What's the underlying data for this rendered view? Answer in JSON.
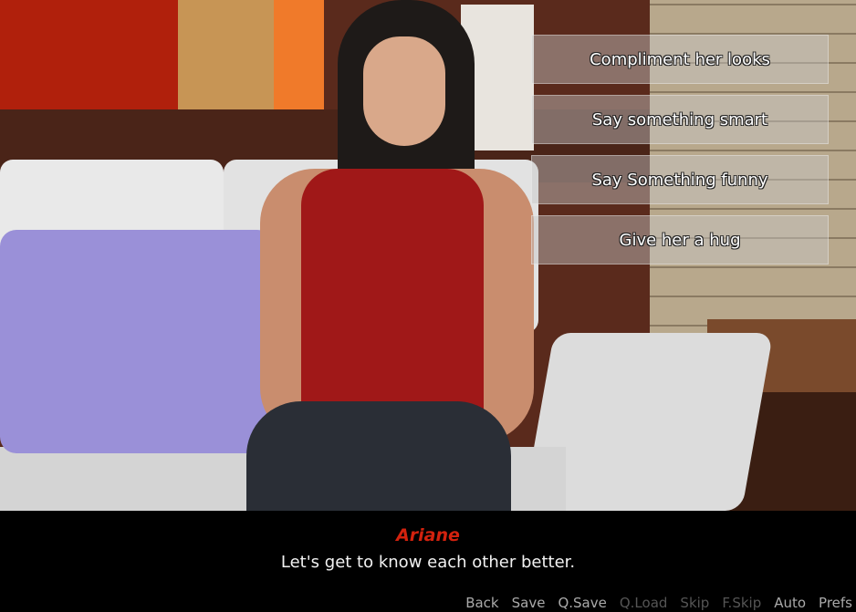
{
  "choices": [
    "Compliment her looks",
    "Say something smart",
    "Say Something funny",
    "Give her a hug"
  ],
  "dialogue": {
    "speaker": "Ariane",
    "text": "Let's get to know each other better.",
    "speaker_color": "#d3220e"
  },
  "quick_menu": [
    {
      "label": "Back",
      "enabled": true
    },
    {
      "label": "Save",
      "enabled": true
    },
    {
      "label": "Q.Save",
      "enabled": true
    },
    {
      "label": "Q.Load",
      "enabled": false
    },
    {
      "label": "Skip",
      "enabled": false
    },
    {
      "label": "F.Skip",
      "enabled": false
    },
    {
      "label": "Auto",
      "enabled": true
    },
    {
      "label": "Prefs",
      "enabled": true
    }
  ]
}
